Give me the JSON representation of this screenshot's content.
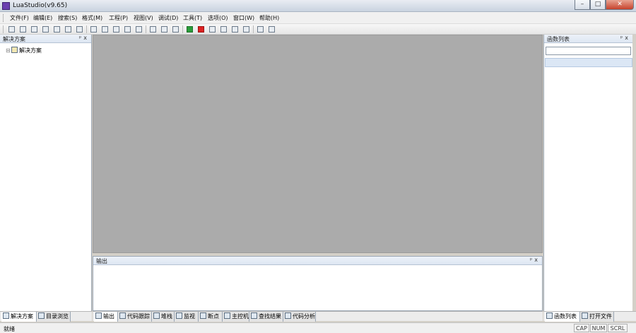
{
  "window": {
    "title": "LuaStudio(v9.65)",
    "minimize_glyph": "–",
    "maximize_glyph": "□",
    "close_glyph": "✕"
  },
  "menu": [
    "文件(F)",
    "编辑(E)",
    "搜索(S)",
    "格式(M)",
    "工程(P)",
    "视图(V)",
    "调试(D)",
    "工具(T)",
    "选项(O)",
    "窗口(W)",
    "帮助(H)"
  ],
  "toolbar_icons": [
    "new-file-icon",
    "new-project-icon",
    "open-icon",
    "open-folder-icon",
    "save-icon",
    "save-all-icon",
    "print-icon",
    "copy-icon",
    "cut-icon",
    "paste-icon",
    "undo-icon",
    "redo-icon",
    "find-icon",
    "replace-icon",
    "bookmark-icon",
    "run-icon",
    "stop-icon",
    "step-into-icon",
    "step-over-icon",
    "step-out-icon",
    "breakpoint-icon",
    "settings-icon",
    "help-icon"
  ],
  "left_panel": {
    "title": "解决方案",
    "pin_glyph": "ᵖ",
    "close_glyph": "x",
    "tree_expander": "⊟",
    "tree_root": "解决方案"
  },
  "left_tabs": [
    {
      "label": "解决方案",
      "icon": "solution-icon",
      "active": true
    },
    {
      "label": "目录浏览",
      "icon": "folder-browse-icon",
      "active": false
    }
  ],
  "output_panel": {
    "title": "输出",
    "pin_glyph": "ᵖ",
    "close_glyph": "x"
  },
  "bottom_tabs": [
    {
      "label": "输出",
      "icon": "output-icon",
      "active": true
    },
    {
      "label": "代码跟踪",
      "icon": "trace-icon",
      "active": false
    },
    {
      "label": "堆栈",
      "icon": "stack-icon",
      "active": false
    },
    {
      "label": "监视",
      "icon": "watch-icon",
      "active": false
    },
    {
      "label": "断点",
      "icon": "breakpoint-list-icon",
      "active": false
    },
    {
      "label": "主控机",
      "icon": "host-icon",
      "active": false
    },
    {
      "label": "查找结果",
      "icon": "find-results-icon",
      "active": false
    },
    {
      "label": "代码分析",
      "icon": "code-analysis-icon",
      "active": false
    }
  ],
  "right_panel": {
    "title": "函数列表",
    "pin_glyph": "ᵖ",
    "close_glyph": "x",
    "search_value": ""
  },
  "right_tabs": [
    {
      "label": "函数列表",
      "icon": "function-list-icon",
      "active": true
    },
    {
      "label": "打开文件",
      "icon": "open-files-icon",
      "active": false
    }
  ],
  "statusbar": {
    "text": "就绪",
    "cap": "CAP",
    "num": "NUM",
    "scrl": "SCRL"
  }
}
